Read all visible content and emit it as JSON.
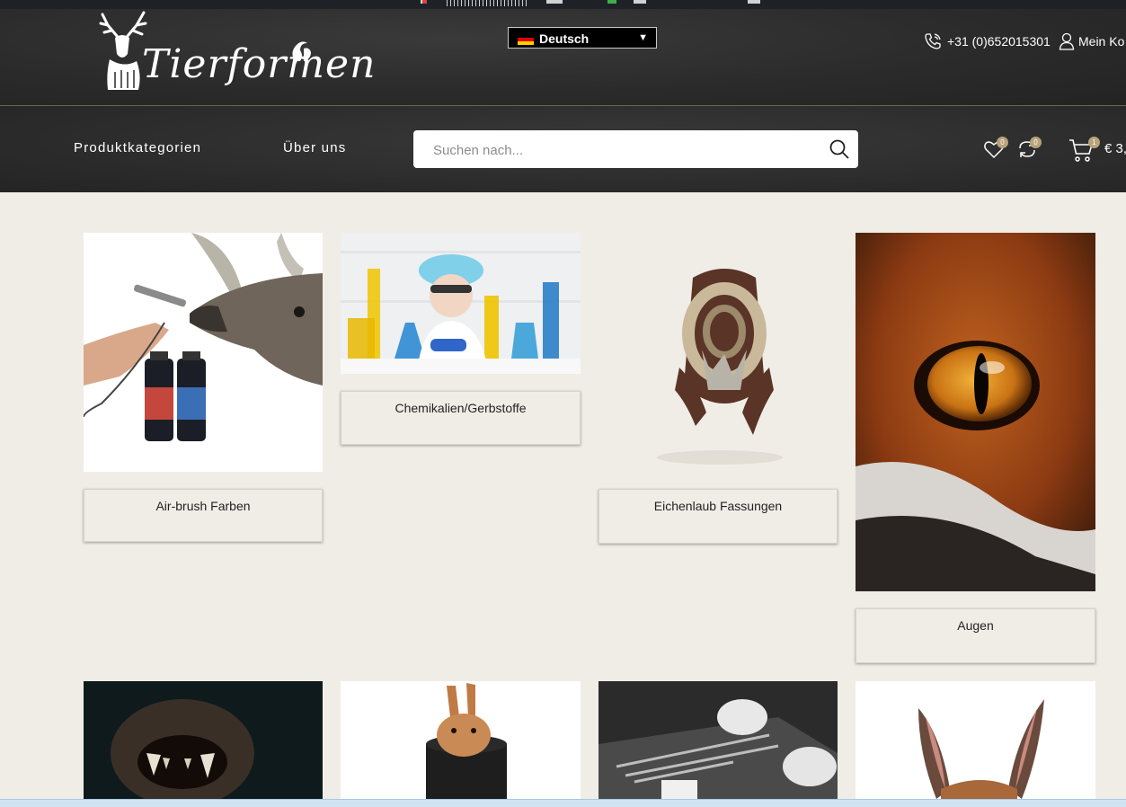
{
  "brand": {
    "logo_text": "Tierformen"
  },
  "language": {
    "selected": "Deutsch"
  },
  "contact": {
    "phone": "+31 (0)652015301",
    "account_label": "Mein Ko"
  },
  "nav": {
    "items": [
      {
        "label": "Produktkategorien"
      },
      {
        "label": "Über uns"
      }
    ]
  },
  "search": {
    "placeholder": "Suchen nach..."
  },
  "header_icons": {
    "wishlist_count": "0",
    "compare_count": "0",
    "cart_count": "1",
    "cart_total": "€ 3,"
  },
  "categories": [
    {
      "label": "Air-brush Farben",
      "image": "airbrush-deer-image"
    },
    {
      "label": "Chemikalien/Gerbstoffe",
      "image": "lab-chemicals-image"
    },
    {
      "label": "Eichenlaub Fassungen",
      "image": "oak-leaf-mount-image"
    },
    {
      "label": "Augen",
      "image": "fox-eye-image"
    }
  ],
  "row2_images": [
    {
      "image": "predator-teeth-image"
    },
    {
      "image": "rabbit-in-box-image"
    },
    {
      "image": "taxidermy-tools-image"
    },
    {
      "image": "deer-ears-image"
    }
  ],
  "colors": {
    "page_bg": "#f0ede7",
    "header_bg": "#2b2b2b",
    "badge_gold": "#b9a37a"
  }
}
